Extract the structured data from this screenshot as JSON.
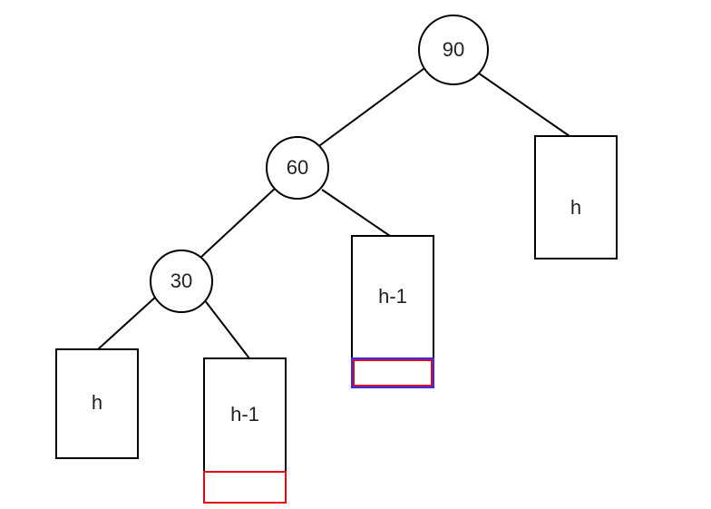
{
  "nodes": {
    "root": "90",
    "left": "60",
    "leftleft": "30"
  },
  "subtrees": {
    "rightOfRoot": "h",
    "rightOfLeft": "h-1",
    "leftOfLeftLeft": "h",
    "rightOfLeftLeft": "h-1"
  }
}
